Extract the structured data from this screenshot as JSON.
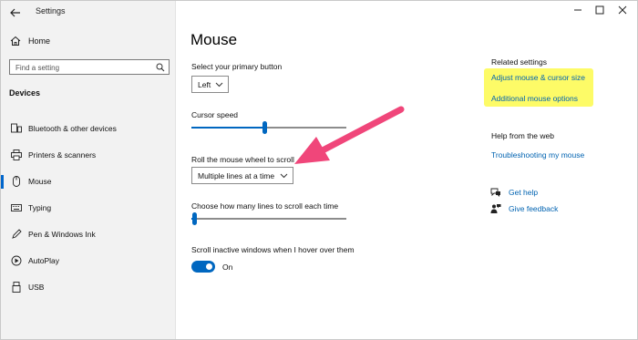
{
  "window": {
    "title": "Settings",
    "controls": [
      "minimize-icon",
      "maximize-icon",
      "close-icon"
    ]
  },
  "sidebar": {
    "home_label": "Home",
    "search_placeholder": "Find a setting",
    "section_title": "Devices",
    "items": [
      {
        "label": "Bluetooth & other devices",
        "icon": "bluetooth-devices-icon"
      },
      {
        "label": "Printers & scanners",
        "icon": "printer-icon"
      },
      {
        "label": "Mouse",
        "icon": "mouse-icon",
        "selected": true
      },
      {
        "label": "Typing",
        "icon": "keyboard-icon"
      },
      {
        "label": "Pen & Windows Ink",
        "icon": "pen-icon"
      },
      {
        "label": "AutoPlay",
        "icon": "autoplay-icon"
      },
      {
        "label": "USB",
        "icon": "usb-icon"
      }
    ]
  },
  "main": {
    "title": "Mouse",
    "primary_button": {
      "label": "Select your primary button",
      "value": "Left"
    },
    "cursor_speed": {
      "label": "Cursor speed",
      "value_fraction": 0.47
    },
    "wheel_scroll": {
      "label": "Roll the mouse wheel to scroll",
      "value": "Multiple lines at a time"
    },
    "lines_to_scroll": {
      "label": "Choose how many lines to scroll each time",
      "value_fraction": 0.02
    },
    "inactive_scroll": {
      "label": "Scroll inactive windows when I hover over them",
      "state": "On"
    }
  },
  "related": {
    "title": "Related settings",
    "links": [
      "Adjust mouse & cursor size",
      "Additional mouse options"
    ],
    "highlight_color": "#fdfb67"
  },
  "help": {
    "title": "Help from the web",
    "link": "Troubleshooting my mouse",
    "get_help": "Get help",
    "give_feedback": "Give feedback"
  },
  "colors": {
    "accent": "#0067c0",
    "link": "#0063b1",
    "arrow": "#f0467a"
  }
}
